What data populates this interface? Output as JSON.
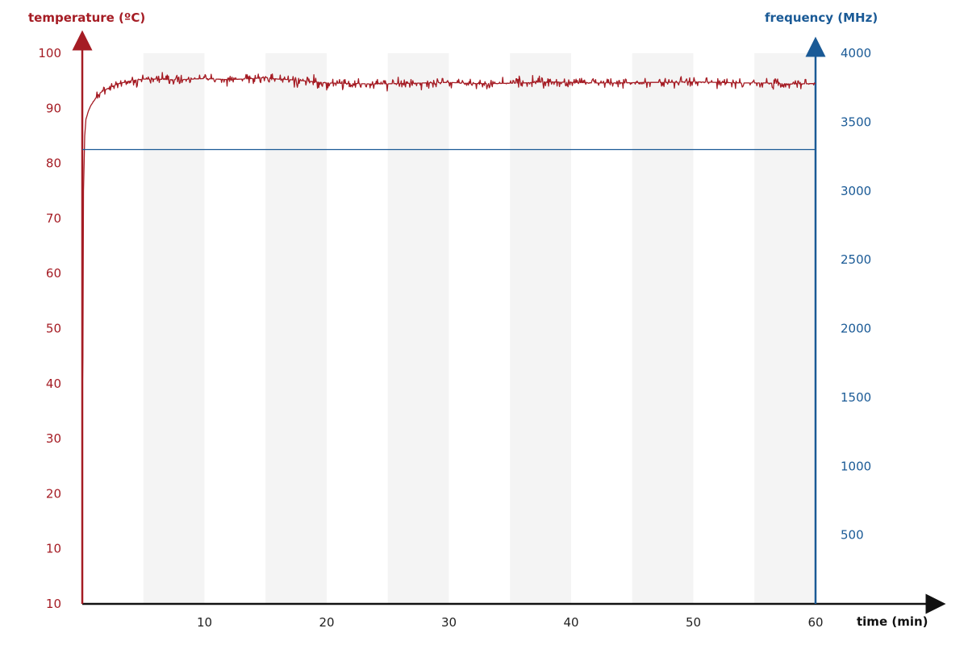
{
  "chart_data": {
    "type": "line",
    "title": "",
    "xlabel": "time (min)",
    "ylabel_left": "temperature (ºC)",
    "ylabel_right": "frequency (MHz)",
    "xlim": [
      0,
      60
    ],
    "ylim_left": [
      0,
      100
    ],
    "ylim_right": [
      0,
      4000
    ],
    "x_tick_labels": [
      "10",
      "20",
      "30",
      "40",
      "50",
      "60"
    ],
    "y_left_tick_labels": [
      "10",
      "10",
      "20",
      "30",
      "40",
      "50",
      "60",
      "70",
      "80",
      "90",
      "100"
    ],
    "y_right_tick_labels": [
      "500",
      "1000",
      "1500",
      "2000",
      "2500",
      "3000",
      "3500",
      "4000"
    ],
    "background_bands_x": [
      [
        5,
        10
      ],
      [
        15,
        20
      ],
      [
        25,
        30
      ],
      [
        35,
        40
      ],
      [
        45,
        50
      ],
      [
        55,
        60
      ]
    ],
    "colors": {
      "temperature": "#a51c24",
      "frequency": "#1a5a96",
      "band": "#f4f4f4",
      "x_axis": "#111111"
    },
    "series": [
      {
        "name": "temperature (ºC)",
        "axis": "left",
        "x": [
          0,
          0.05,
          0.1,
          0.2,
          0.3,
          0.5,
          0.7,
          1.0,
          1.3,
          1.6,
          2.0,
          2.5,
          3.0,
          4.0,
          5.0,
          6.0,
          7.0,
          8.0,
          9.0,
          10.0,
          11.0,
          12.0,
          13.0,
          14.0,
          15.0,
          16.0,
          17.0,
          18.0,
          19.0,
          20.0,
          22.0,
          24.0,
          26.0,
          28.0,
          30.0,
          32.0,
          34.0,
          36.0,
          38.0,
          40.0,
          42.0,
          44.0,
          46.0,
          48.0,
          50.0,
          52.0,
          54.0,
          56.0,
          58.0,
          60.0
        ],
        "values": [
          37,
          45,
          75,
          85,
          88,
          89.5,
          90.5,
          91.5,
          92.5,
          93,
          93.5,
          94,
          94.5,
          95,
          95.3,
          95.3,
          95.2,
          95.2,
          95.3,
          95.4,
          95.3,
          95.2,
          95.3,
          95.4,
          95.6,
          95.3,
          95.2,
          95,
          94.8,
          94.6,
          94.5,
          94.4,
          94.5,
          94.6,
          94.7,
          94.5,
          94.5,
          94.6,
          94.8,
          94.7,
          94.6,
          94.6,
          94.7,
          94.7,
          94.8,
          94.7,
          94.6,
          94.6,
          94.4,
          94.5
        ]
      },
      {
        "name": "frequency (MHz)",
        "axis": "right",
        "x": [
          0,
          60
        ],
        "values": [
          3300,
          3300
        ]
      }
    ]
  }
}
